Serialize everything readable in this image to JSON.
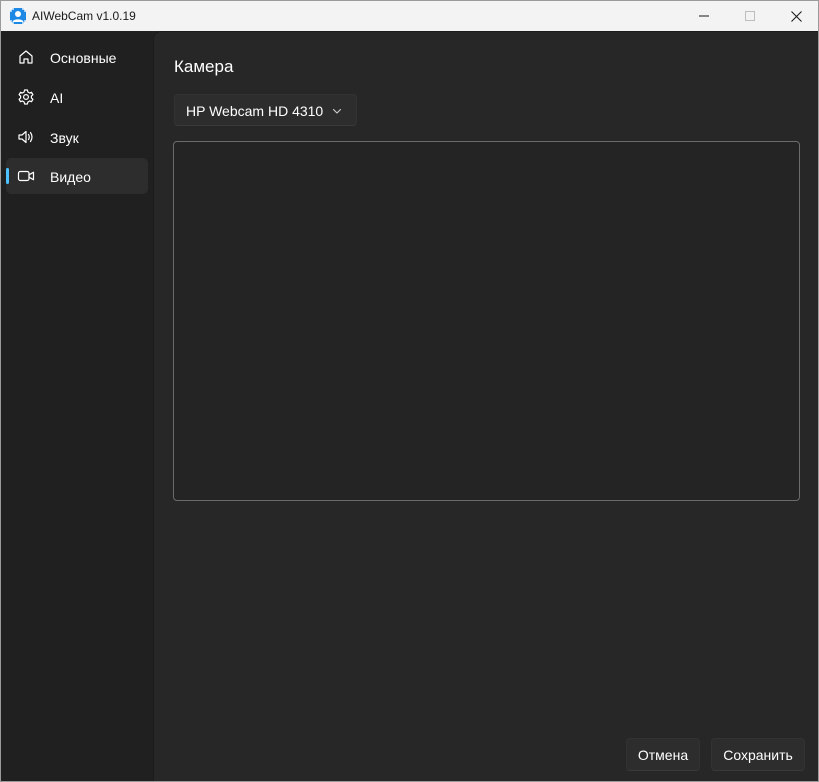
{
  "app": {
    "title": "AIWebCam v1.0.19",
    "icon": "person-camera-icon",
    "accent_color": "#4cc2ff"
  },
  "window_controls": {
    "minimize_icon": "minimize-icon",
    "maximize_icon": "maximize-icon",
    "close_icon": "close-icon"
  },
  "sidebar": {
    "items": [
      {
        "label": "Основные",
        "icon": "home-icon",
        "active": false
      },
      {
        "label": "AI",
        "icon": "gear-icon",
        "active": false
      },
      {
        "label": "Звук",
        "icon": "speaker-icon",
        "active": false
      },
      {
        "label": "Видео",
        "icon": "video-camera-icon",
        "active": true
      }
    ]
  },
  "main": {
    "section_title": "Камера",
    "camera_select": {
      "value": "HP Webcam HD 4310",
      "icon": "chevron-down-icon"
    }
  },
  "footer": {
    "cancel_label": "Отмена",
    "save_label": "Сохранить"
  }
}
